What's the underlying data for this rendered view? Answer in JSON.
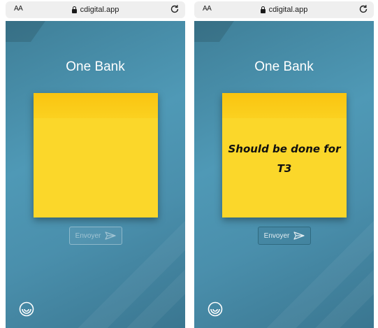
{
  "browser": {
    "text_size_label": "AA",
    "url": "cdigital.app"
  },
  "app": {
    "title": "One Bank"
  },
  "screens": [
    {
      "note_text": "",
      "send_label": "Envoyer",
      "send_enabled": false
    },
    {
      "note_text": "Should be done for T3",
      "send_label": "Envoyer",
      "send_enabled": true
    }
  ],
  "icons": {
    "lock": "lock-icon",
    "reload": "reload-icon",
    "send": "send-icon",
    "logo": "app-logo-icon"
  },
  "colors": {
    "app_background": "#4a93b0",
    "sticky_note": "#fbd72a",
    "sticky_note_header": "#f9c410"
  }
}
